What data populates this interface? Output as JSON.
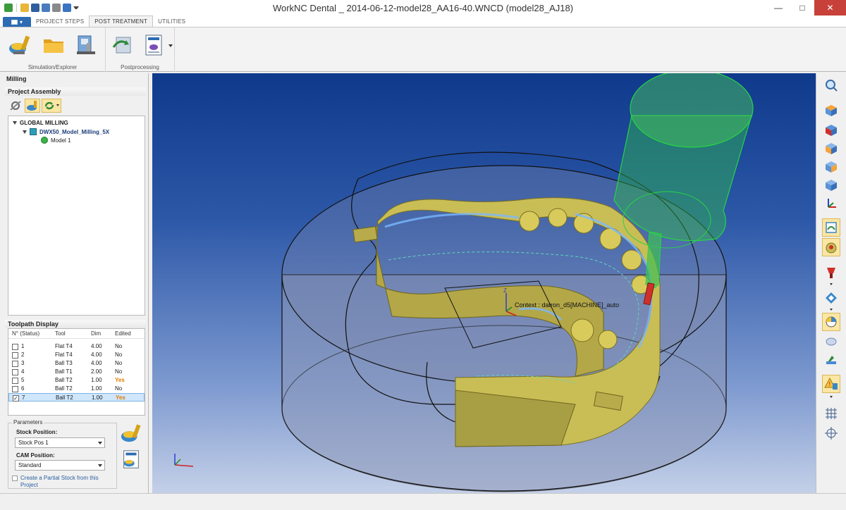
{
  "window": {
    "title": "WorkNC Dental _ 2014-06-12-model28_AA16-40.WNCD (model28_AJ18)"
  },
  "colors": {
    "accent": "#2d6bb3",
    "close": "#c7413a",
    "yes": "#e07a00",
    "selected": "#cfe6fb"
  },
  "ribbon": {
    "tabs": [
      {
        "label": "PROJECT STEPS"
      },
      {
        "label": "POST TREATMENT"
      },
      {
        "label": "UTILITIES"
      }
    ],
    "active_tab": "POST TREATMENT",
    "groups": [
      {
        "label": "Simulation/Explorer"
      },
      {
        "label": "Postprocessing"
      }
    ]
  },
  "left_panel": {
    "title": "Milling",
    "assembly": {
      "header": "Project Assembly",
      "tree": [
        {
          "label": "GLOBAL MILLING"
        },
        {
          "label": "DWX50_Model_Milling_5X"
        },
        {
          "label": "Model 1"
        }
      ]
    },
    "toolpath": {
      "header": "Toolpath Display",
      "columns": [
        "N° (Status)",
        "Tool",
        "Dim",
        "Edited"
      ],
      "rows": [
        {
          "num": "1",
          "tool": "Flat T4",
          "dim": "4.00",
          "edited": "No"
        },
        {
          "num": "2",
          "tool": "Flat T4",
          "dim": "4.00",
          "edited": "No"
        },
        {
          "num": "3",
          "tool": "Ball T3",
          "dim": "4.00",
          "edited": "No"
        },
        {
          "num": "4",
          "tool": "Ball T1",
          "dim": "2.00",
          "edited": "No"
        },
        {
          "num": "5",
          "tool": "Ball T2",
          "dim": "1.00",
          "edited": "Yes"
        },
        {
          "num": "6",
          "tool": "Ball T2",
          "dim": "1.00",
          "edited": "No"
        },
        {
          "num": "7",
          "tool": "Ball T2",
          "dim": "1.00",
          "edited": "Yes"
        }
      ],
      "selected_row": "7"
    },
    "parameters": {
      "legend": "Parameters",
      "stock_label": "Stock Position:",
      "stock_value": "Stock Pos 1",
      "cam_label": "CAM Position:",
      "cam_value": "Standard",
      "partial_stock": "Create a Partial Stock from this Project"
    }
  },
  "viewport": {
    "context_label": "Context : datron_d5[MACHINE]_auto",
    "axis_z": "Z"
  }
}
